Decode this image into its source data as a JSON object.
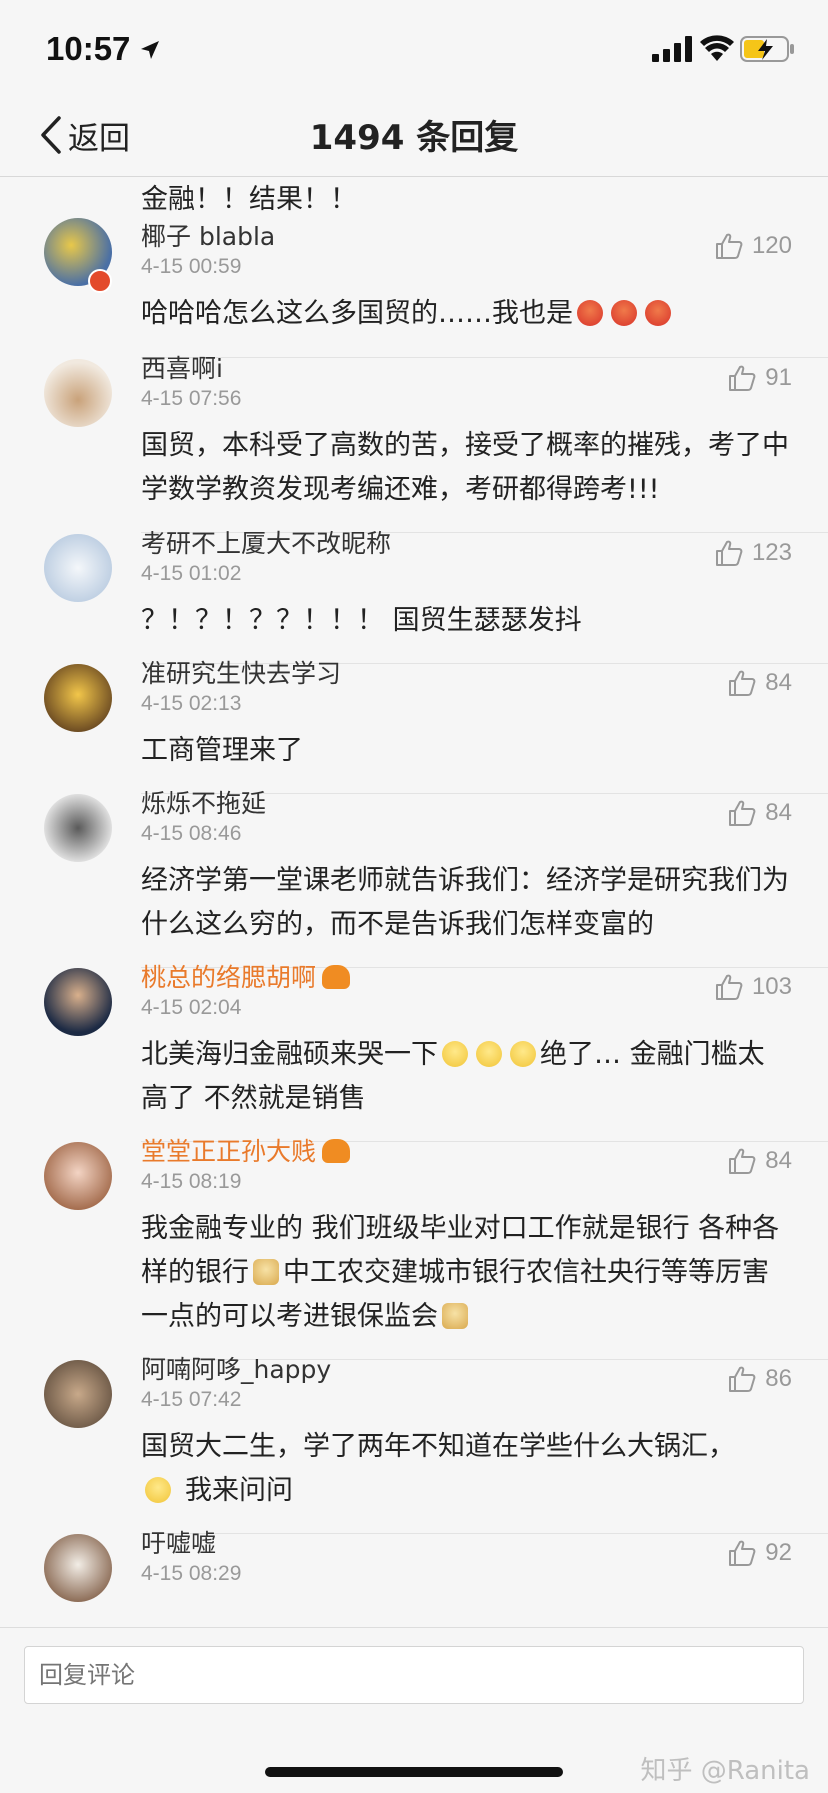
{
  "status": {
    "time": "10:57"
  },
  "nav": {
    "back_label": "返回",
    "title": "1494 条回复"
  },
  "partial_top": "金融！！结果！！",
  "comments": [
    {
      "name": "椰子 blabla",
      "date": "4-15 00:59",
      "likes": "120",
      "text": "哈哈哈怎么这么多国贸的……我也是"
    },
    {
      "name": "西喜啊i",
      "date": "4-15 07:56",
      "likes": "91",
      "text": "国贸，本科受了高数的苦，接受了概率的摧残，考了中学数学教资发现考编还难，考研都得跨考!!!"
    },
    {
      "name": "考研不上厦大不改昵称",
      "date": "4-15 01:02",
      "likes": "123",
      "text": "？！？！？？！！！ 国贸生瑟瑟发抖"
    },
    {
      "name": "准研究生快去学习",
      "date": "4-15 02:13",
      "likes": "84",
      "text": "工商管理来了"
    },
    {
      "name": "烁烁不拖延",
      "date": "4-15 08:46",
      "likes": "84",
      "text": "经济学第一堂课老师就告诉我们：经济学是研究我们为什么这么穷的，而不是告诉我们怎样变富的"
    },
    {
      "name": "桃总的络腮胡啊",
      "date": "4-15 02:04",
      "likes": "103",
      "text_a": "北美海归金融硕来哭一下",
      "text_b": "绝了… 金融门槛太高了 不然就是销售"
    },
    {
      "name": "堂堂正正孙大贱",
      "date": "4-15 08:19",
      "likes": "84",
      "text_a": "我金融专业的 我们班级毕业对口工作就是银行 各种各样的银行",
      "text_b": "中工农交建城市银行农信社央行等等厉害一点的可以考进银保监会"
    },
    {
      "name": "阿喃阿哆_happy",
      "date": "4-15 07:42",
      "likes": "86",
      "text_a": "国贸大二生，学了两年不知道在学些什么大锅汇，",
      "text_b": "我来问问"
    },
    {
      "name": "吁嘘嘘",
      "date": "4-15 08:29",
      "likes": "92"
    }
  ],
  "reply": {
    "placeholder": "回复评论"
  },
  "watermark": "知乎 @Ranita",
  "colors": {
    "vip_name": "#e97a2b",
    "meta_gray": "#999999"
  }
}
